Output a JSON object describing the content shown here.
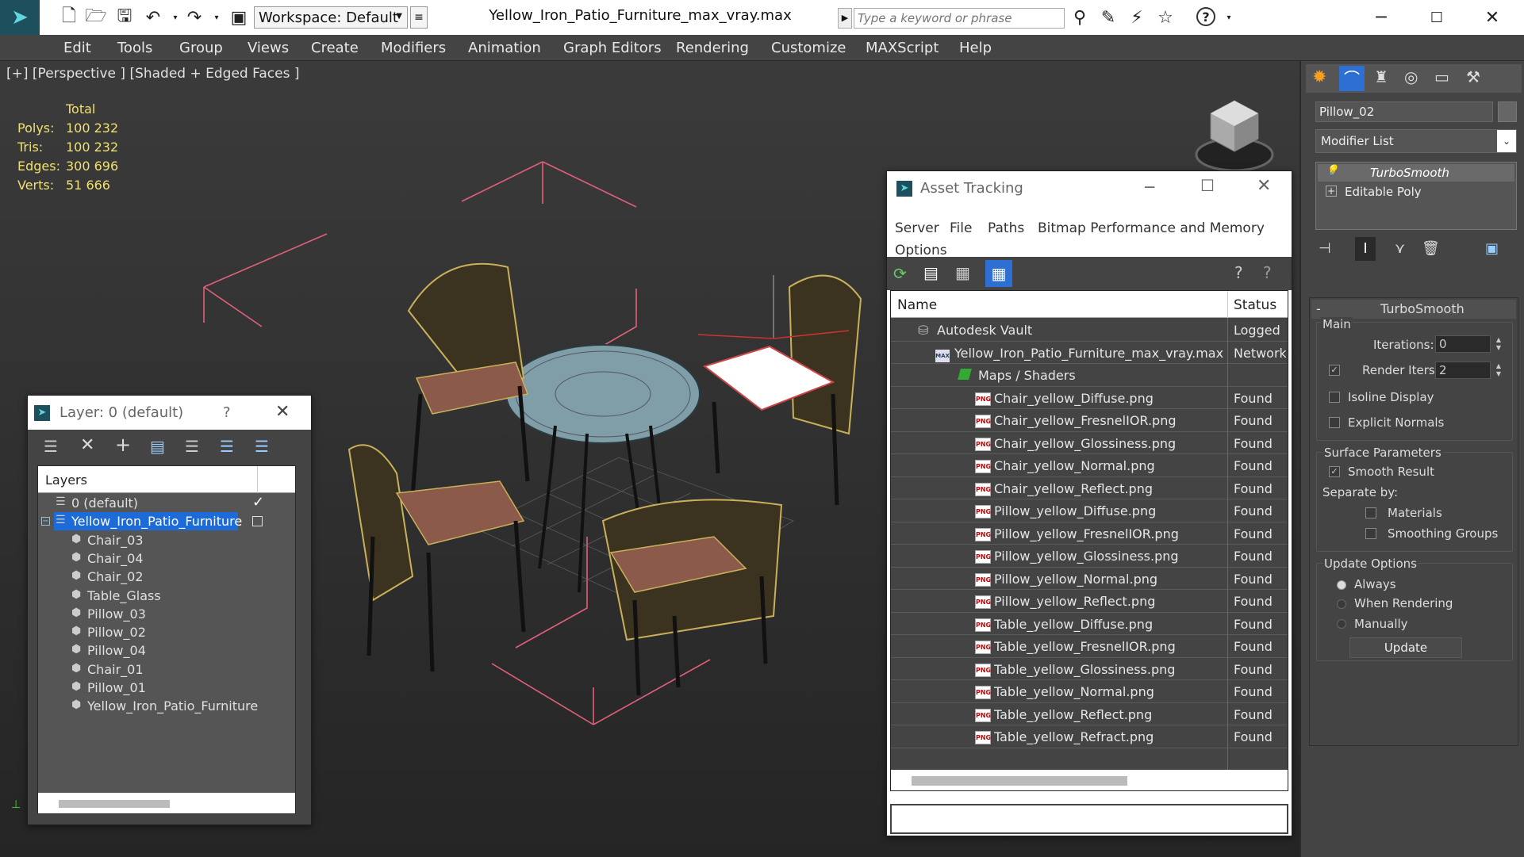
{
  "titlebar": {
    "workspace": "Workspace: Default",
    "filename": "Yellow_Iron_Patio_Furniture_max_vray.max",
    "search_placeholder": "Type a keyword or phrase"
  },
  "menu": [
    "Edit",
    "Tools",
    "Group",
    "Views",
    "Create",
    "Modifiers",
    "Animation",
    "Graph Editors",
    "Rendering",
    "Customize",
    "MAXScript",
    "Help"
  ],
  "viewport": {
    "label": "[+] [Perspective ] [Shaded + Edged Faces ]",
    "stats_header": "Total",
    "stats": [
      {
        "label": "Polys:",
        "value": "100 232"
      },
      {
        "label": "Tris:",
        "value": "100 232"
      },
      {
        "label": "Edges:",
        "value": "300 696"
      },
      {
        "label": "Verts:",
        "value": "51 666"
      }
    ]
  },
  "layer_dialog": {
    "title": "Layer: 0 (default)",
    "help": "?",
    "column_header": "Layers",
    "rows": [
      {
        "name": "0 (default)"
      },
      {
        "name": "Yellow_Iron_Patio_Furniture"
      },
      {
        "name": "Chair_03"
      },
      {
        "name": "Chair_04"
      },
      {
        "name": "Chair_02"
      },
      {
        "name": "Table_Glass"
      },
      {
        "name": "Pillow_03"
      },
      {
        "name": "Pillow_02"
      },
      {
        "name": "Pillow_04"
      },
      {
        "name": "Chair_01"
      },
      {
        "name": "Pillow_01"
      },
      {
        "name": "Yellow_Iron_Patio_Furniture"
      }
    ]
  },
  "asset_tracking": {
    "title": "Asset Tracking",
    "menu": [
      "Server",
      "File",
      "Paths",
      "Bitmap Performance and Memory",
      "Options"
    ],
    "col_name": "Name",
    "col_status": "Status",
    "rows": [
      {
        "name": "Autodesk Vault",
        "status": "Logged"
      },
      {
        "name": "Yellow_Iron_Patio_Furniture_max_vray.max",
        "status": "Network"
      },
      {
        "name": "Maps / Shaders",
        "status": ""
      },
      {
        "name": "Chair_yellow_Diffuse.png",
        "status": "Found"
      },
      {
        "name": "Chair_yellow_FresnelIOR.png",
        "status": "Found"
      },
      {
        "name": "Chair_yellow_Glossiness.png",
        "status": "Found"
      },
      {
        "name": "Chair_yellow_Normal.png",
        "status": "Found"
      },
      {
        "name": "Chair_yellow_Reflect.png",
        "status": "Found"
      },
      {
        "name": "Pillow_yellow_Diffuse.png",
        "status": "Found"
      },
      {
        "name": "Pillow_yellow_FresnelIOR.png",
        "status": "Found"
      },
      {
        "name": "Pillow_yellow_Glossiness.png",
        "status": "Found"
      },
      {
        "name": "Pillow_yellow_Normal.png",
        "status": "Found"
      },
      {
        "name": "Pillow_yellow_Reflect.png",
        "status": "Found"
      },
      {
        "name": "Table_yellow_Diffuse.png",
        "status": "Found"
      },
      {
        "name": "Table_yellow_FresnelIOR.png",
        "status": "Found"
      },
      {
        "name": "Table_yellow_Glossiness.png",
        "status": "Found"
      },
      {
        "name": "Table_yellow_Normal.png",
        "status": "Found"
      },
      {
        "name": "Table_yellow_Reflect.png",
        "status": "Found"
      },
      {
        "name": "Table_yellow_Refract.png",
        "status": "Found"
      }
    ],
    "png_badge": "PNG"
  },
  "command_panel": {
    "object_name": "Pillow_02",
    "modifier_list": "Modifier List",
    "stack": [
      "TurboSmooth",
      "Editable Poly"
    ],
    "rollout_title": "TurboSmooth",
    "rollout_toggle": "-",
    "main": "Main",
    "iterations_label": "Iterations:",
    "iterations_value": "0",
    "render_iters_label": "Render Iters:",
    "render_iters_value": "2",
    "isoline": "Isoline Display",
    "explicit_normals": "Explicit Normals",
    "surface_params": "Surface Parameters",
    "smooth_result": "Smooth Result",
    "separate_by": "Separate by:",
    "materials": "Materials",
    "smoothing_groups": "Smoothing Groups",
    "update_options": "Update Options",
    "always": "Always",
    "when_rendering": "When Rendering",
    "manually": "Manually",
    "update_button": "Update"
  },
  "colors": {
    "accent": "#1c67d6",
    "stat_yellow": "#f0e070",
    "panel": "#444444",
    "selected_row": "#1c6bd9"
  }
}
